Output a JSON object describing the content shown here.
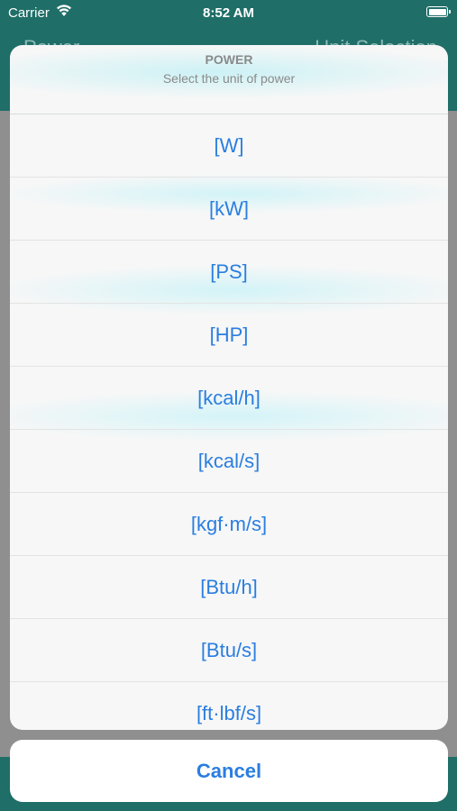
{
  "status_bar": {
    "carrier": "Carrier",
    "time": "8:52 AM"
  },
  "background_app": {
    "nav_left_title": "Power",
    "nav_right_title": "Unit Selection"
  },
  "action_sheet": {
    "title": "POWER",
    "message": "Select the unit of power",
    "options": [
      "[W]",
      "[kW]",
      "[PS]",
      "[HP]",
      "[kcal/h]",
      "[kcal/s]",
      "[kgf·m/s]",
      "[Btu/h]",
      "[Btu/s]",
      "[ft·lbf/s]"
    ],
    "cancel_label": "Cancel"
  },
  "colors": {
    "accent": "#2a7ee0",
    "nav_background": "#1f6e68"
  }
}
